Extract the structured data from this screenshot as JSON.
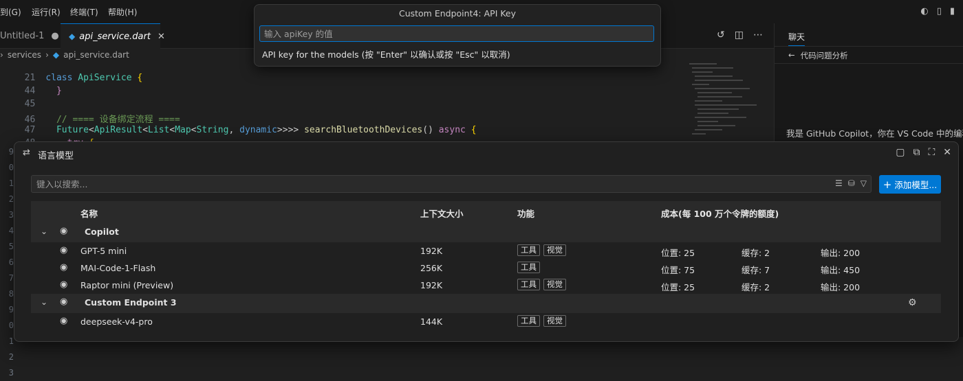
{
  "menubar": {
    "items": [
      "到(G)",
      "运行(R)",
      "终端(T)",
      "帮助(H)"
    ]
  },
  "tabs": [
    {
      "label": "Untitled-1"
    },
    {
      "label": "api_service.dart"
    }
  ],
  "breadcrumb": [
    "services",
    "api_service.dart"
  ],
  "editor": {
    "lines": [
      {
        "num": "21",
        "code": "class ApiService {"
      },
      {
        "num": "44",
        "code": "  }"
      },
      {
        "num": "45",
        "code": ""
      },
      {
        "num": "46",
        "code": "  // ==== 设备绑定流程 ===="
      },
      {
        "num": "47",
        "code": "  Future<ApiResult<List<Map<String, dynamic>>>> searchBluetoothDevices() async {"
      },
      {
        "num": "48",
        "code": "    try {"
      }
    ]
  },
  "chat_panel": {
    "title": "聊天",
    "back_label": "代码问题分析",
    "intro": "我是 GitHub Copilot，你在 VS Code 中的编程"
  },
  "palette": {
    "title": "Custom Endpoint4: API Key",
    "placeholder": "输入 apiKey 的值",
    "message": "API key for the models (按 \"Enter\" 以确认或按 \"Esc\" 以取消)"
  },
  "dialog": {
    "title": "语言模型",
    "search_placeholder": "键入以搜索...",
    "add_button": "添加模型...",
    "columns": {
      "name": "名称",
      "context": "上下文大小",
      "capabilities": "功能",
      "cost": "成本(每 100 万个令牌的额度)"
    },
    "groups": [
      {
        "name": "Copilot",
        "models": [
          {
            "name": "GPT-5 mini",
            "context": "192K",
            "caps": [
              "工具",
              "视觉"
            ],
            "input": "位置: 25",
            "cache": "缓存: 2",
            "output": "输出: 200"
          },
          {
            "name": "MAI-Code-1-Flash",
            "context": "256K",
            "caps": [
              "工具"
            ],
            "input": "位置: 75",
            "cache": "缓存: 7",
            "output": "输出: 450"
          },
          {
            "name": "Raptor mini (Preview)",
            "context": "192K",
            "caps": [
              "工具",
              "视觉"
            ],
            "input": "位置: 25",
            "cache": "缓存: 2",
            "output": "输出: 200"
          }
        ]
      },
      {
        "name": "Custom Endpoint 3",
        "models": [
          {
            "name": "deepseek-v4-pro",
            "context": "144K",
            "caps": [
              "工具",
              "视觉"
            ],
            "input": "",
            "cache": "",
            "output": ""
          }
        ]
      }
    ]
  }
}
